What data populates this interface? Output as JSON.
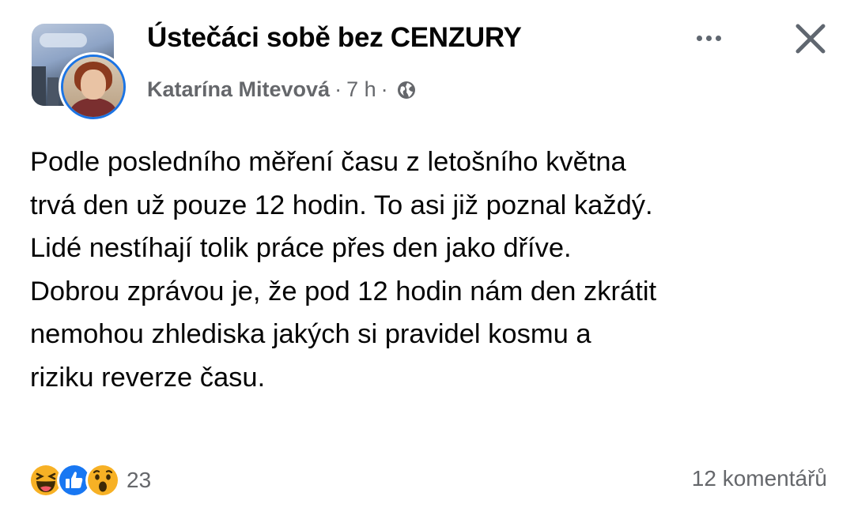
{
  "post": {
    "group_name": "Ústečáci sobě bez CENZURY",
    "author": "Katarína Mitevová",
    "separator": "·",
    "time": "7 h",
    "separator2": "·",
    "privacy_icon": "globe-icon",
    "menu_icon": "more-icon",
    "close_icon": "close-icon",
    "text_lines": [
      "Podle posledního měření času z letošního května",
      "trvá den už pouze 12 hodin. To asi již poznal každý.",
      "Lidé nestíhají tolik práce přes den jako dříve.",
      "Dobrou zprávou je, že pod 12 hodin nám den zkrátit",
      "nemohou zhlediska jakých si pravidel kosmu a",
      "riziku reverze času."
    ],
    "reactions": {
      "icons": [
        "haha-icon",
        "like-icon",
        "wow-icon"
      ],
      "count": "23"
    },
    "comments_label": "12 komentářů"
  },
  "colors": {
    "accent": "#1b74e4",
    "text": "#050505",
    "secondary": "#65676b",
    "like": "#1877f2",
    "emoji": "#f7b125"
  }
}
